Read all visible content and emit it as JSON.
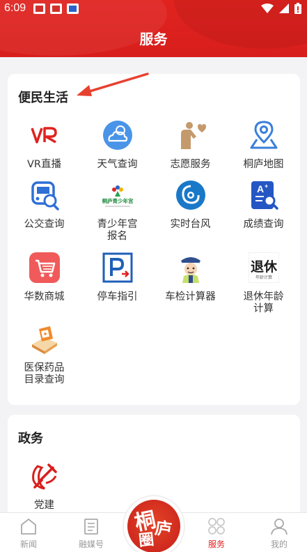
{
  "status_bar": {
    "time": "6:09"
  },
  "header": {
    "title": "服务"
  },
  "life_section": {
    "title": "便民生活",
    "items": [
      {
        "label": "VR直播",
        "icon": "vr-icon"
      },
      {
        "label": "天气查询",
        "icon": "weather-cloud-icon"
      },
      {
        "label": "志愿服务",
        "icon": "volunteer-icon"
      },
      {
        "label": "桐庐地图",
        "icon": "map-pin-icon"
      },
      {
        "label": "公交查询",
        "icon": "bus-search-icon"
      },
      {
        "label": "青少年宫报名",
        "icon": "youth-palace-icon"
      },
      {
        "label": "实时台风",
        "icon": "typhoon-icon"
      },
      {
        "label": "成绩查询",
        "icon": "score-search-icon"
      },
      {
        "label": "华数商城",
        "icon": "shopping-cart-icon"
      },
      {
        "label": "停车指引",
        "icon": "parking-icon"
      },
      {
        "label": "车检计算器",
        "icon": "traffic-police-icon"
      },
      {
        "label": "退休年龄计算",
        "icon": "retirement-icon"
      },
      {
        "label": "医保药品目录查询",
        "icon": "medicine-icon"
      }
    ],
    "youth_palace_logo_text": "桐庐青少年宫",
    "retirement_icon_text": "退休",
    "retirement_icon_subtext": "年龄计算"
  },
  "gov_section": {
    "title": "政务",
    "items": [
      {
        "label": "党建",
        "icon": "party-emblem-icon"
      }
    ]
  },
  "bottom_nav": {
    "items": [
      {
        "label": "新闻",
        "icon": "home-icon",
        "active": false
      },
      {
        "label": "融媒号",
        "icon": "media-doc-icon",
        "active": false
      },
      {
        "label": "服务",
        "icon": "services-grid-icon",
        "active": true
      },
      {
        "label": "我的",
        "icon": "user-icon",
        "active": false
      }
    ],
    "logo_chars": [
      "桐",
      "庐",
      "圈"
    ]
  },
  "colors": {
    "brand_red": "#e0231f",
    "background": "#f3f3f5"
  }
}
